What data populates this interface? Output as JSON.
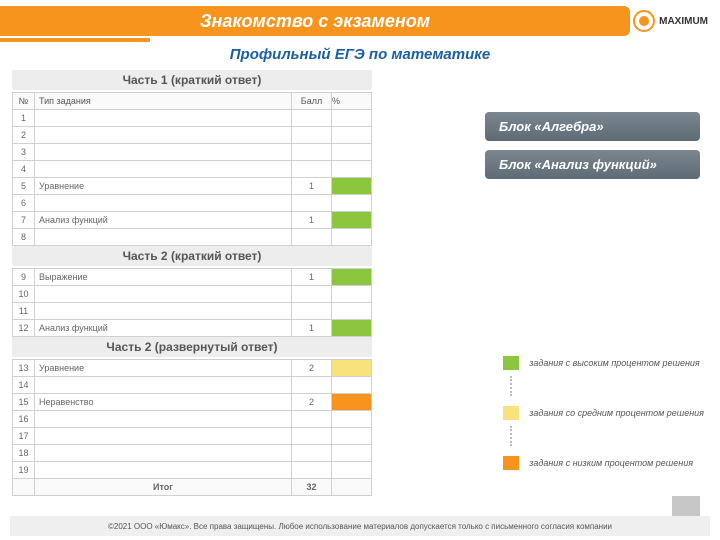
{
  "header": {
    "title": "Знакомство с экзаменом",
    "logo": "MAXIMUM"
  },
  "subtitle": "Профильный ЕГЭ по математике",
  "sections": {
    "part1": "Часть 1 (краткий ответ)",
    "part2a": "Часть 2 (краткий ответ)",
    "part2b": "Часть 2 (развернутый ответ)"
  },
  "columns": {
    "num": "№",
    "type": "Тип задания",
    "score": "Балл",
    "pct": "%"
  },
  "rows_p1": [
    {
      "n": "1",
      "t": "",
      "s": "",
      "c": ""
    },
    {
      "n": "2",
      "t": "",
      "s": "",
      "c": ""
    },
    {
      "n": "3",
      "t": "",
      "s": "",
      "c": ""
    },
    {
      "n": "4",
      "t": "",
      "s": "",
      "c": ""
    },
    {
      "n": "5",
      "t": "Уравнение",
      "s": "1",
      "c": "green"
    },
    {
      "n": "6",
      "t": "",
      "s": "",
      "c": ""
    },
    {
      "n": "7",
      "t": "Анализ функций",
      "s": "1",
      "c": "green"
    },
    {
      "n": "8",
      "t": "",
      "s": "",
      "c": ""
    }
  ],
  "rows_p2a": [
    {
      "n": "9",
      "t": "Выражение",
      "s": "1",
      "c": "green"
    },
    {
      "n": "10",
      "t": "",
      "s": "",
      "c": ""
    },
    {
      "n": "11",
      "t": "",
      "s": "",
      "c": ""
    },
    {
      "n": "12",
      "t": "Анализ функций",
      "s": "1",
      "c": "green"
    }
  ],
  "rows_p2b": [
    {
      "n": "13",
      "t": "Уравнение",
      "s": "2",
      "c": "yellow"
    },
    {
      "n": "14",
      "t": "",
      "s": "",
      "c": ""
    },
    {
      "n": "15",
      "t": "Неравенство",
      "s": "2",
      "c": "orange"
    },
    {
      "n": "16",
      "t": "",
      "s": "",
      "c": ""
    },
    {
      "n": "17",
      "t": "",
      "s": "",
      "c": ""
    },
    {
      "n": "18",
      "t": "",
      "s": "",
      "c": ""
    },
    {
      "n": "19",
      "t": "",
      "s": "",
      "c": ""
    }
  ],
  "total": {
    "label": "Итог",
    "value": "32"
  },
  "blocks": {
    "b1": "Блок «Алгебра»",
    "b2": "Блок «Анализ функций»"
  },
  "legend": {
    "hi": "задания с высоким процентом решения",
    "mid": "задания со средним процентом решения",
    "low": "задания с низким процентом решения"
  },
  "footer": "©2021 ООО «Юмакс». Все права защищены. Любое использование материалов допускается только с письменного согласия компании"
}
